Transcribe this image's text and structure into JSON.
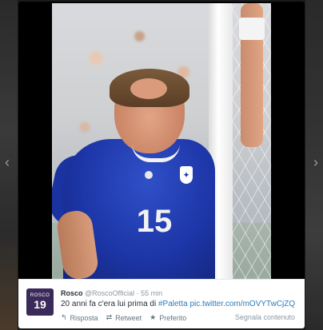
{
  "lightbox": {
    "prev_arrow": "‹",
    "next_arrow": "›"
  },
  "photo": {
    "jersey_number": "15"
  },
  "tweet": {
    "avatar": {
      "top_text": "ROSCO",
      "number": "19"
    },
    "name": "Rosco",
    "handle": "@RoscoOfficial",
    "separator": "·",
    "time": "55 min",
    "text_prefix": "20 anni fa c'era lui prima di ",
    "hashtag": "#Paletta",
    "link": "pic.twitter.com/mOVYTwCjZQ",
    "actions": {
      "reply": "Risposta",
      "retweet": "Retweet",
      "favorite": "Preferito"
    },
    "report": "Segnala contenuto"
  },
  "colors": {
    "link": "#2b7bb9",
    "jersey": "#1d36a8",
    "text": "#292f33",
    "muted": "#8899a6"
  },
  "icons": [
    "reply-icon",
    "retweet-icon",
    "favorite-star-icon",
    "chevron-left-icon",
    "chevron-right-icon"
  ]
}
